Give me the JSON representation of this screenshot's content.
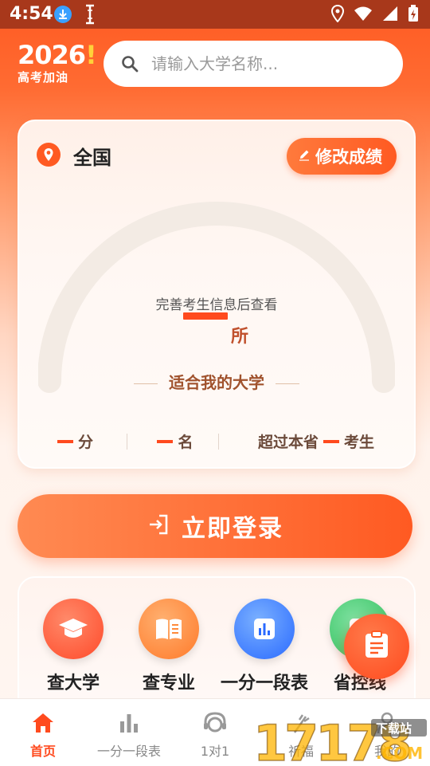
{
  "status_bar": {
    "time": "4:54"
  },
  "header": {
    "brand_year": "2026",
    "brand_mark": "!",
    "brand_slogan": "高考加油",
    "search_placeholder": "请输入大学名称..."
  },
  "score_card": {
    "location": "全国",
    "edit_button": "修改成绩",
    "gauge_hint": "完善考生信息后查看",
    "gauge_unit": "所",
    "gauge_caption": "适合我的大学",
    "stats": {
      "score_unit": "分",
      "rank_unit": "名",
      "exceed_prefix": "超过本省",
      "exceed_suffix": "考生"
    }
  },
  "login_button": "立即登录",
  "tools": [
    {
      "label": "查大学",
      "icon": "graduation-cap-icon",
      "color": "#ff5a3a"
    },
    {
      "label": "查专业",
      "icon": "book-icon",
      "color": "#ff8a3a"
    },
    {
      "label": "一分一段表",
      "icon": "bar-chart-icon",
      "color": "#3a7aff"
    },
    {
      "label": "省控线",
      "icon": "line-icon",
      "color": "#3ec46a"
    }
  ],
  "bottom_nav": [
    {
      "label": "首页",
      "icon": "home-icon",
      "active": true
    },
    {
      "label": "一分一段表",
      "icon": "bar-chart-icon",
      "active": false
    },
    {
      "label": "1对1",
      "icon": "headset-icon",
      "active": false
    },
    {
      "label": "祈福",
      "icon": "wish-icon",
      "active": false
    },
    {
      "label": "我的",
      "icon": "user-icon",
      "active": false
    }
  ],
  "watermark": {
    "number": "17178",
    "suffix": "下载站",
    "domain": ".COM"
  },
  "colors": {
    "accent": "#ff5a22",
    "accent_dark": "#ff4a1e",
    "status_bar": "#a8381b"
  }
}
